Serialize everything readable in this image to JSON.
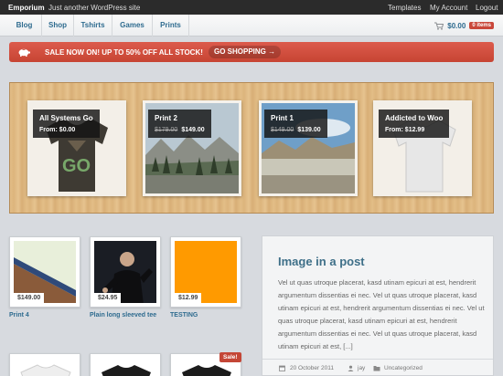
{
  "topbar": {
    "site_name": "Emporium",
    "tagline": "Just another WordPress site",
    "links": [
      "Templates",
      "My Account",
      "Logout"
    ]
  },
  "nav": {
    "items": [
      "Blog",
      "Shop",
      "Tshirts",
      "Games",
      "Prints"
    ],
    "cart_total": "$0.00",
    "cart_count": "0 items"
  },
  "sale_banner": {
    "message": "SALE NOW ON! UP TO 50% OFF ALL STOCK!",
    "cta": "GO SHOPPING →"
  },
  "featured": [
    {
      "title": "All Systems Go",
      "price_prefix": "From:",
      "price": "$0.00",
      "old_price": ""
    },
    {
      "title": "Print 2",
      "price_prefix": "",
      "price": "$149.00",
      "old_price": "$179.00"
    },
    {
      "title": "Print 1",
      "price_prefix": "",
      "price": "$139.00",
      "old_price": "$149.00"
    },
    {
      "title": "Addicted to Woo",
      "price_prefix": "From:",
      "price": "$12.99",
      "old_price": ""
    }
  ],
  "products": [
    {
      "name": "Print 4",
      "price": "$149.00"
    },
    {
      "name": "Plain long sleeved tee",
      "price": "$24.95"
    },
    {
      "name": "TESTING",
      "price": "$12.99"
    }
  ],
  "sale_tag": "Sale!",
  "post": {
    "title": "Image in a post",
    "excerpt": "Vel ut quas utroque placerat, kasd utinam epicuri at est, hendrerit argumentum dissentias ei nec. Vel ut quas utroque placerat, kasd utinam epicuri at est, hendrerit argumentum dissentias ei nec. Vel ut quas utroque placerat, kasd utinam epicuri at est, hendrerit argumentum dissentias ei nec. Vel ut quas utroque placerat, kasd utinam epicuri at est, [...]",
    "date": "20 October 2011",
    "author": "jay",
    "category": "Uncategorized"
  },
  "colors": {
    "accent_link": "#2e6b8f",
    "sale_red": "#c9473a",
    "topbar": "#2b2b2b"
  }
}
